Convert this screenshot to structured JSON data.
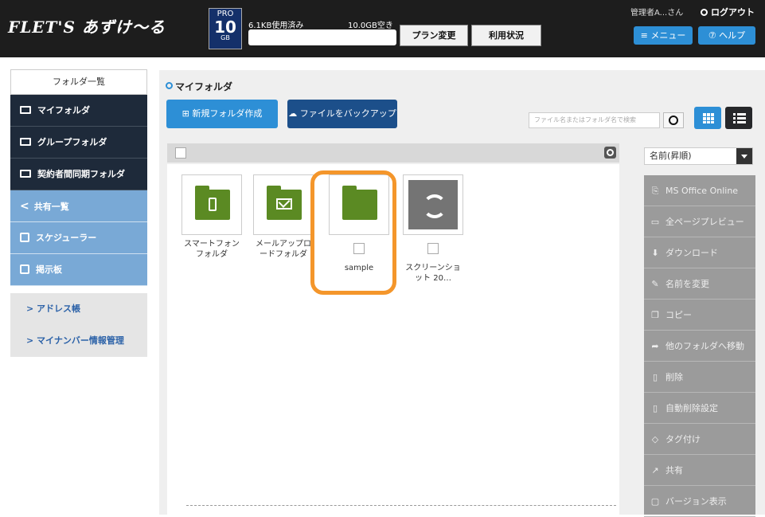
{
  "header": {
    "logo": "FLET'S あずけ〜る",
    "plan": {
      "line1": "PRO",
      "line2": "10",
      "line3": "GB"
    },
    "usage_used": "6.1KB使用済み",
    "usage_free": "10.0GB空き",
    "plan_change_label": "プラン変更",
    "usage_status_label": "利用状況",
    "user_name": "管理者A...さん",
    "logout_label": "ログアウト",
    "menu_label": "≡ メニュー",
    "help_label": "⑦ ヘルプ"
  },
  "sidebar": {
    "title": "フォルダ一覧",
    "dark_items": [
      {
        "label": "マイフォルダ"
      },
      {
        "label": "グループフォルダ"
      },
      {
        "label": "契約者間同期フォルダ"
      }
    ],
    "light_items": [
      {
        "label": "共有一覧"
      },
      {
        "label": "スケジューラー"
      },
      {
        "label": "掲示板"
      }
    ],
    "gray_items": [
      {
        "label": "> アドレス帳"
      },
      {
        "label": "> マイナンバー情報管理"
      }
    ]
  },
  "main": {
    "breadcrumb": "マイフォルダ",
    "new_folder_label": "新規フォルダ作成",
    "backup_label": "ファイルをバックアップ",
    "search_placeholder": "ファイル名またはフォルダ名で検索",
    "sort_label": "名前(昇順)",
    "files": [
      {
        "name_line1": "スマートフォン",
        "name_line2": "フォルダ",
        "icon": "smartphone-folder-icon"
      },
      {
        "name_line1": "メールアップロ",
        "name_line2": "ードフォルダ",
        "icon": "mail-folder-icon"
      },
      {
        "name_line1": "sample",
        "name_line2": "",
        "icon": "folder-icon"
      },
      {
        "name_line1": "スクリーンショ",
        "name_line2": "ット 20…",
        "icon": "sync-icon"
      }
    ]
  },
  "right_panel": {
    "items": [
      {
        "label": "MS Office Online",
        "icon": "office-icon",
        "glyph": "⎘"
      },
      {
        "label": "全ページプレビュー",
        "icon": "preview-icon",
        "glyph": "▭"
      },
      {
        "label": "ダウンロード",
        "icon": "download-icon",
        "glyph": "⬇"
      },
      {
        "label": "名前を変更",
        "icon": "rename-icon",
        "glyph": "✎"
      },
      {
        "label": "コピー",
        "icon": "copy-icon",
        "glyph": "❐"
      },
      {
        "label": "他のフォルダへ移動",
        "icon": "move-icon",
        "glyph": "➦"
      },
      {
        "label": "削除",
        "icon": "delete-icon",
        "glyph": "▯"
      },
      {
        "label": "自動削除設定",
        "icon": "auto-delete-icon",
        "glyph": "▯"
      },
      {
        "label": "タグ付け",
        "icon": "tag-icon",
        "glyph": "◇"
      },
      {
        "label": "共有",
        "icon": "share-icon",
        "glyph": "↗"
      },
      {
        "label": "バージョン表示",
        "icon": "version-icon",
        "glyph": "▢"
      }
    ]
  },
  "colors": {
    "accent_blue": "#2d8fd6",
    "folder_green": "#5b8a23",
    "highlight_orange": "#f4962b",
    "sidebar_dark": "#1e2a3a",
    "sidebar_light": "#79a9d6"
  }
}
